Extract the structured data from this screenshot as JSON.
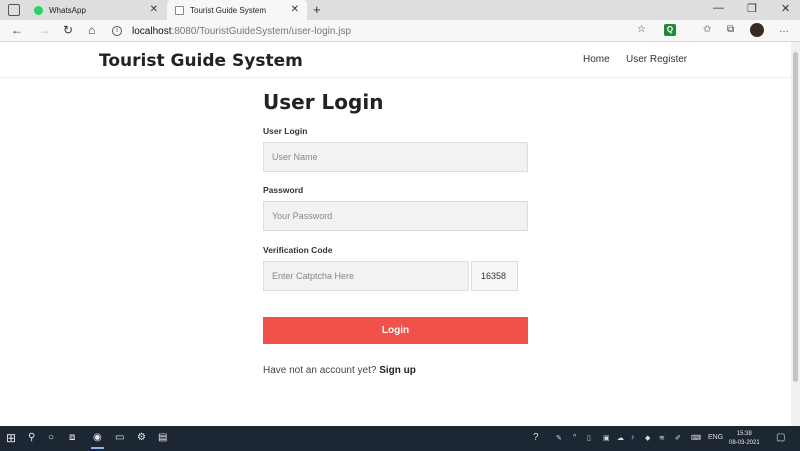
{
  "browser": {
    "tabs": [
      {
        "title": "WhatsApp",
        "active": false,
        "favicon": "whatsapp-icon"
      },
      {
        "title": "Tourist Guide System",
        "active": true,
        "favicon": "document-icon"
      }
    ],
    "address": {
      "host": "localhost",
      "path": ":8080/TouristGuideSystem/user-login.jsp"
    },
    "window_controls": {
      "minimize": "—",
      "maximize": "❐",
      "close": "✕"
    },
    "extension_label": "Q"
  },
  "site": {
    "brand": "Tourist Guide System",
    "nav": [
      "Home",
      "User Register"
    ]
  },
  "form": {
    "title": "User Login",
    "username_label": "User Login",
    "username_placeholder": "User Name",
    "password_label": "Password",
    "password_placeholder": "Your Password",
    "captcha_label": "Verification Code",
    "captcha_placeholder": "Enter Catptcha Here",
    "captcha_code": "16358",
    "login_button": "Login",
    "signup_text": "Have not an account yet?",
    "signup_link": "Sign up"
  },
  "colors": {
    "accent": "#f0524a",
    "taskbar": "#1c2733"
  },
  "taskbar": {
    "time": "15:38",
    "date": "08-03-2021",
    "language": "ENG"
  }
}
